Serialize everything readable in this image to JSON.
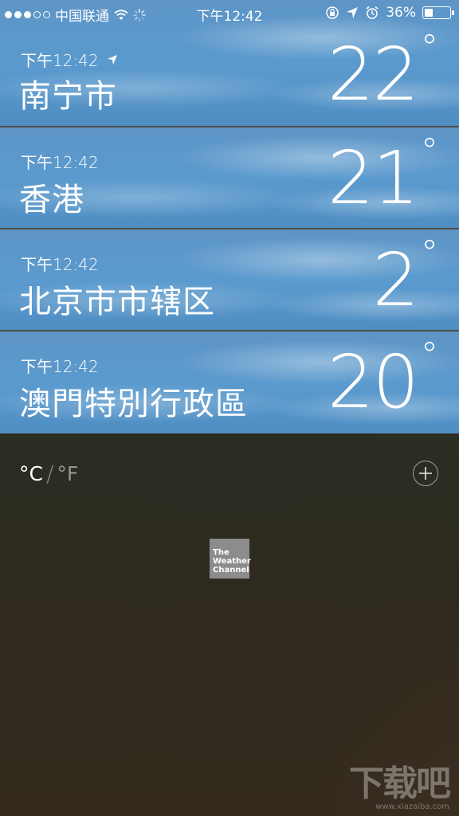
{
  "status_bar": {
    "carrier": "中国联通",
    "time": "下午12:42",
    "battery": "36%",
    "battery_level": 0.36
  },
  "cities": [
    {
      "time": "下午12:42",
      "name": "南宁市",
      "temp": "22",
      "deg": "°",
      "location_icon": "location-arrow-icon"
    },
    {
      "time": "下午12:42",
      "name": "香港",
      "temp": "21",
      "deg": "°"
    },
    {
      "time": "下午12:42",
      "name": "北京市市辖区",
      "temp": "2",
      "deg": "°"
    },
    {
      "time": "下午12:42",
      "name": "澳門特別行政區",
      "temp": "20",
      "deg": "°"
    }
  ],
  "units": {
    "celsius": "°C",
    "separator": "/",
    "fahrenheit": "°F"
  },
  "add_button_icon": "plus-circle-icon",
  "twc_logo": "The Weather Channel",
  "watermark": {
    "text": "下载吧",
    "url": "www.xiazaiba.com"
  }
}
